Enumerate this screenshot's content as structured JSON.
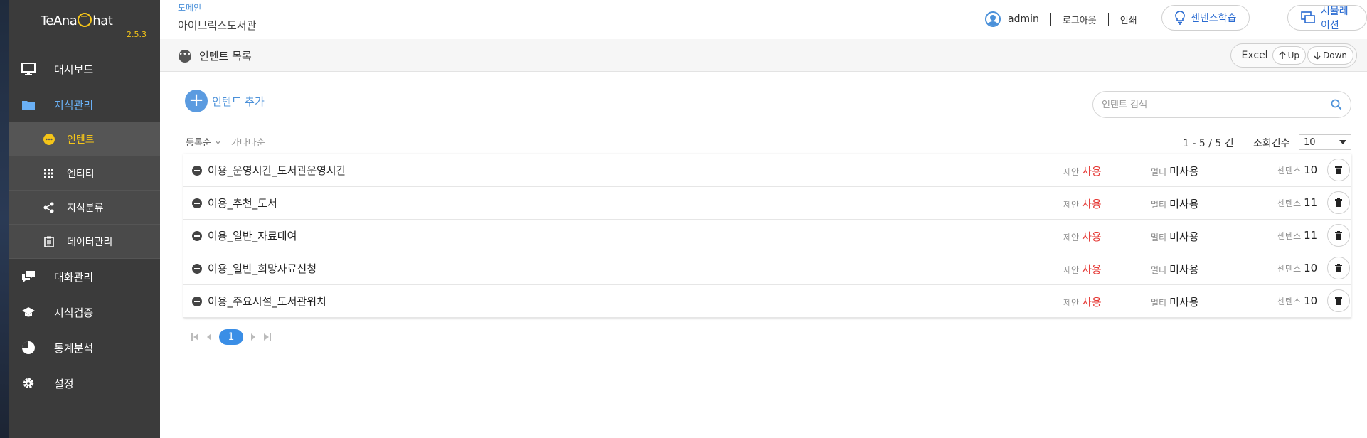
{
  "app": {
    "logo_text_left": "TeAna",
    "logo_text_right": "hat",
    "version": "2.5.3"
  },
  "sidebar": {
    "items": [
      {
        "label": "대시보드",
        "icon": "monitor-icon"
      },
      {
        "label": "지식관리",
        "icon": "folder-icon",
        "active": true
      },
      {
        "label": "대화관리",
        "icon": "chat-icon"
      },
      {
        "label": "지식검증",
        "icon": "graduation-cap-icon"
      },
      {
        "label": "통계분석",
        "icon": "pie-chart-icon"
      },
      {
        "label": "설정",
        "icon": "gear-icon"
      }
    ],
    "subitems": [
      {
        "label": "인텐트",
        "icon": "chat-bubble-icon",
        "active": true
      },
      {
        "label": "엔티티",
        "icon": "grid-icon"
      },
      {
        "label": "지식분류",
        "icon": "share-icon"
      },
      {
        "label": "데이터관리",
        "icon": "clipboard-icon"
      }
    ]
  },
  "header": {
    "domain_label": "도메인",
    "domain_name": "아이브릭스도서관",
    "user": "admin",
    "logout": "로그아웃",
    "print": "인쇄",
    "btn_sentence_learning": "센텐스학습",
    "btn_simulation": "시뮬레이션"
  },
  "titlebar": {
    "title": "인텐트 목록",
    "excel": "Excel",
    "up": "Up",
    "down": "Down"
  },
  "content": {
    "add_label": "인텐트 추가",
    "search_placeholder": "인텐트 검색",
    "sort_active": "등록순",
    "sort_other": "가나다순",
    "count_text": "1 - 5 / 5 건",
    "page_size_label": "조회건수",
    "page_size_value": "10",
    "labels": {
      "proposal": "제안",
      "multi": "멀티",
      "sentence": "센텐스"
    },
    "rows": [
      {
        "name": "이용_운영시간_도서관운영시간",
        "proposal": "사용",
        "multi": "미사용",
        "sentences": "10"
      },
      {
        "name": "이용_추천_도서",
        "proposal": "사용",
        "multi": "미사용",
        "sentences": "11"
      },
      {
        "name": "이용_일반_자료대여",
        "proposal": "사용",
        "multi": "미사용",
        "sentences": "11"
      },
      {
        "name": "이용_일반_희망자료신청",
        "proposal": "사용",
        "multi": "미사용",
        "sentences": "10"
      },
      {
        "name": "이용_주요시설_도서관위치",
        "proposal": "사용",
        "multi": "미사용",
        "sentences": "10"
      }
    ],
    "pager": {
      "current": "1"
    }
  },
  "colors": {
    "sidebar_bg": "#3b3b3b",
    "accent_blue": "#4a90d9",
    "accent_yellow": "#f5c518",
    "status_red": "#e53935"
  }
}
